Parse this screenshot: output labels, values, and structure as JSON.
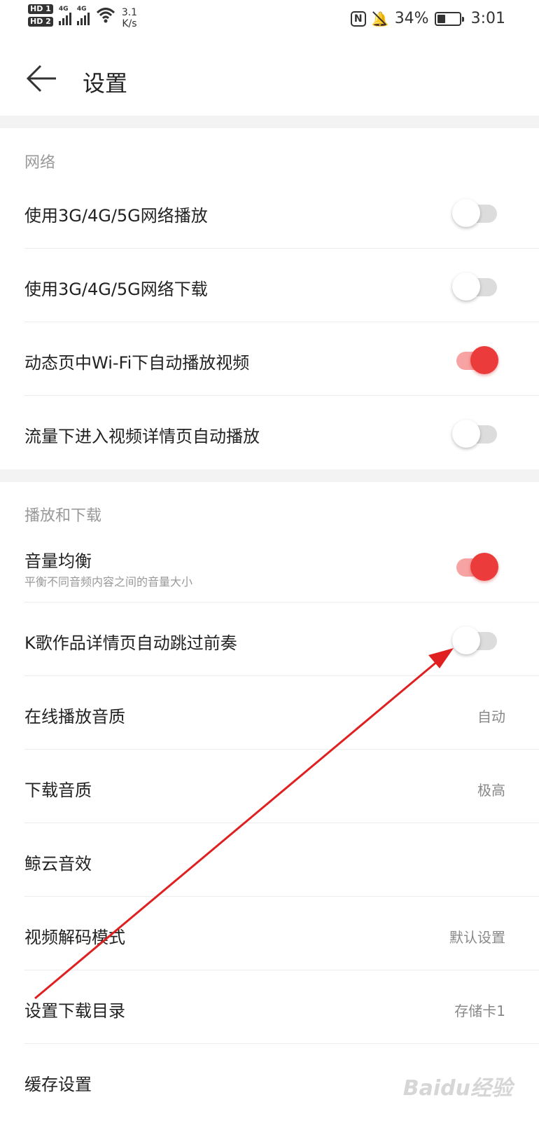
{
  "status_bar": {
    "hd1": "HD 1",
    "hd2": "HD 2",
    "net1": "4G",
    "net2": "4G",
    "speed_value": "3.1",
    "speed_unit": "K/s",
    "nfc": "N",
    "battery": "34%",
    "time": "3:01"
  },
  "header": {
    "back_icon": "back-arrow-icon",
    "title": "设置"
  },
  "sections": {
    "network": {
      "title": "网络",
      "items": [
        {
          "label": "使用3G/4G/5G网络播放",
          "toggle_on": false
        },
        {
          "label": "使用3G/4G/5G网络下载",
          "toggle_on": false
        },
        {
          "label": "动态页中Wi-Fi下自动播放视频",
          "toggle_on": true
        },
        {
          "label": "流量下进入视频详情页自动播放",
          "toggle_on": false
        }
      ]
    },
    "playback": {
      "title": "播放和下载",
      "volume_balance": {
        "label": "音量均衡",
        "sub": "平衡不同音频内容之间的音量大小",
        "toggle_on": true
      },
      "karaoke_skip": {
        "label": "K歌作品详情页自动跳过前奏",
        "toggle_on": false
      },
      "online_quality": {
        "label": "在线播放音质",
        "value": "自动"
      },
      "download_quality": {
        "label": "下载音质",
        "value": "极高"
      },
      "sound_effects": {
        "label": "鲸云音效"
      },
      "video_decode": {
        "label": "视频解码模式",
        "value": "默认设置"
      },
      "download_dir": {
        "label": "设置下载目录",
        "value": "存储卡1"
      },
      "cache": {
        "label": "缓存设置"
      }
    }
  },
  "watermark": "Baidu经验",
  "colors": {
    "accent": "#ec3b3b",
    "accent_track": "#f7a3a3",
    "off_track": "#dcdcdc",
    "annotation_arrow": "#e02020"
  }
}
